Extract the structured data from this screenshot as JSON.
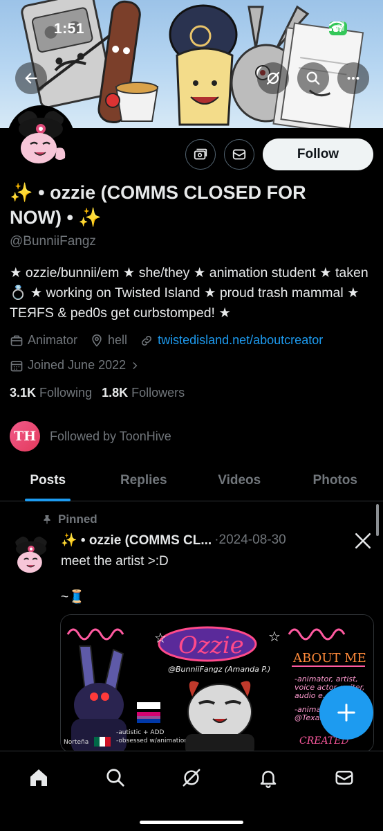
{
  "status_bar": {
    "time": "1:51",
    "battery": "97"
  },
  "header": {
    "back_icon": "arrow-left-icon",
    "grok_icon": "grok-icon",
    "search_icon": "search-icon",
    "more_icon": "ellipsis-icon"
  },
  "profile": {
    "display_name": "✨ • ozzie (COMMS CLOSED FOR NOW) • ✨",
    "handle": "@BunniiFangz",
    "bio": "★ ozzie/bunnii/em ★ she/they ★ animation student ★ taken 💍 ★ working on Twisted Island ★ proud trash mammal ★ TEЯFS & ped0s get curbstomped! ★",
    "profession": "Animator",
    "location": "hell",
    "website": "twistedisland.net/aboutcreator",
    "joined": "Joined June 2022",
    "following_count": "3.1K",
    "following_label": "Following",
    "followers_count": "1.8K",
    "followers_label": "Followers",
    "followed_by": "Followed by ToonHive",
    "followed_by_avatar_text": "TH"
  },
  "actions": {
    "follow_label": "Follow"
  },
  "tabs": [
    {
      "label": "Posts",
      "active": true
    },
    {
      "label": "Replies",
      "active": false
    },
    {
      "label": "Videos",
      "active": false
    },
    {
      "label": "Photos",
      "active": false
    }
  ],
  "post": {
    "pinned_label": "Pinned",
    "author": "✨ • ozzie (COMMS CL...",
    "date": "·2024-08-30",
    "text": "meet the artist >:D",
    "text2": "~🧵"
  },
  "media": {
    "title": "Ozzie",
    "handle_line": "@BunniiFangz (Amanda P.)",
    "about_heading": "ABOUT ME",
    "about_lines": [
      "-animator, artist,",
      "voice actor, writer,",
      "audio e...",
      "-animati...",
      "@Texas"
    ],
    "created_label": "CREATED",
    "left_note": "-autistic + ADD",
    "left_note2": "-obsessed w/animation",
    "nationality": "Norteña"
  },
  "colors": {
    "accent": "#1d9bf0",
    "background": "#000000",
    "muted": "#71767b",
    "text": "#e7e9ea"
  }
}
